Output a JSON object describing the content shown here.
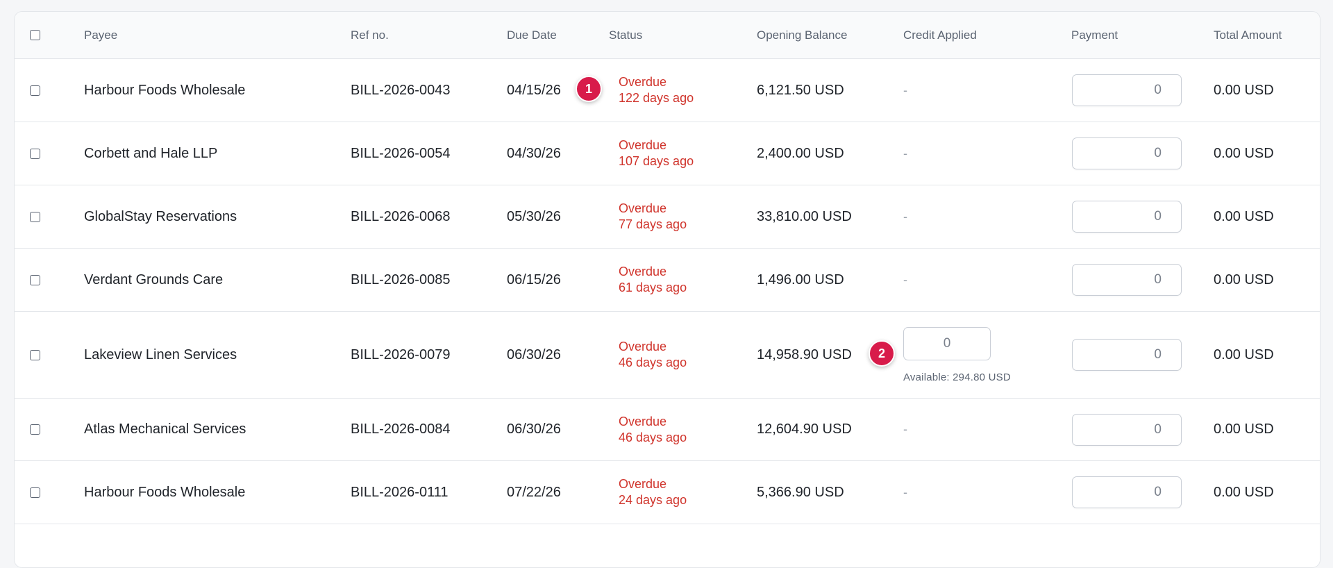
{
  "columns": {
    "payee": "Payee",
    "ref": "Ref no.",
    "due": "Due Date",
    "status": "Status",
    "opening": "Opening Balance",
    "credit": "Credit Applied",
    "payment": "Payment",
    "total": "Total Amount"
  },
  "rows": [
    {
      "payee": "Harbour Foods Wholesale",
      "ref": "BILL-2026-0043",
      "due": "04/15/26",
      "status": "Overdue",
      "age": "122 days ago",
      "opening": "6,121.50 USD",
      "credit": "-",
      "payment": "0",
      "total": "0.00 USD"
    },
    {
      "payee": "Corbett and Hale LLP",
      "ref": "BILL-2026-0054",
      "due": "04/30/26",
      "status": "Overdue",
      "age": "107 days ago",
      "opening": "2,400.00 USD",
      "credit": "-",
      "payment": "0",
      "total": "0.00 USD"
    },
    {
      "payee": "GlobalStay Reservations",
      "ref": "BILL-2026-0068",
      "due": "05/30/26",
      "status": "Overdue",
      "age": "77 days ago",
      "opening": "33,810.00 USD",
      "credit": "-",
      "payment": "0",
      "total": "0.00 USD"
    },
    {
      "payee": "Verdant Grounds Care",
      "ref": "BILL-2026-0085",
      "due": "06/15/26",
      "status": "Overdue",
      "age": "61 days ago",
      "opening": "1,496.00 USD",
      "credit": "-",
      "payment": "0",
      "total": "0.00 USD"
    },
    {
      "payee": "Lakeview Linen Services",
      "ref": "BILL-2026-0079",
      "due": "06/30/26",
      "status": "Overdue",
      "age": "46 days ago",
      "opening": "14,958.90 USD",
      "credit_input": "0",
      "credit_available": "Available: 294.80 USD",
      "payment": "0",
      "total": "0.00 USD"
    },
    {
      "payee": "Atlas Mechanical Services",
      "ref": "BILL-2026-0084",
      "due": "06/30/26",
      "status": "Overdue",
      "age": "46 days ago",
      "opening": "12,604.90 USD",
      "credit": "-",
      "payment": "0",
      "total": "0.00 USD"
    },
    {
      "payee": "Harbour Foods Wholesale",
      "ref": "BILL-2026-0111",
      "due": "07/22/26",
      "status": "Overdue",
      "age": "24 days ago",
      "opening": "5,366.90 USD",
      "credit": "-",
      "payment": "0",
      "total": "0.00 USD"
    }
  ],
  "markers": [
    "1",
    "2"
  ],
  "colors": {
    "overdue": "#d0342c",
    "marker": "#d81b4a",
    "border": "#e3e6ea"
  }
}
